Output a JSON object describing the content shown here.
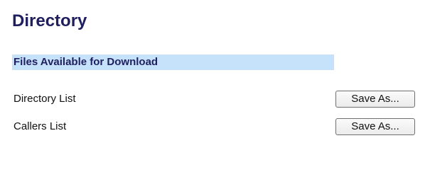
{
  "page": {
    "title": "Directory"
  },
  "section": {
    "header": "Files Available for Download"
  },
  "rows": [
    {
      "label": "Directory List",
      "button_label": "Save As..."
    },
    {
      "label": "Callers List",
      "button_label": "Save As..."
    }
  ],
  "colors": {
    "title_text": "#1f1f5f",
    "section_background": "#c6e2fb"
  }
}
